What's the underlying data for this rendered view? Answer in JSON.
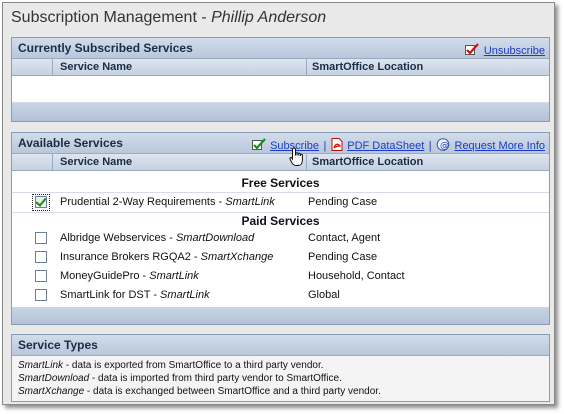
{
  "title": {
    "prefix": "Subscription Management - ",
    "user": "Phillip Anderson"
  },
  "subscribed": {
    "heading": "Currently Subscribed Services",
    "unsubscribe": "Unsubscribe",
    "col_name": "Service Name",
    "col_location": "SmartOffice Location"
  },
  "available": {
    "heading": "Available Services",
    "actions": {
      "subscribe": "Subscribe",
      "sep": "|",
      "pdf": "PDF DataSheet",
      "request": "Request More Info"
    },
    "col_name": "Service Name",
    "col_location": "SmartOffice Location",
    "free_label": "Free Services",
    "paid_label": "Paid Services",
    "free": [
      {
        "name": "Prudential 2-Way Requirements - ",
        "product": "SmartLink",
        "location": "Pending Case",
        "checked": true
      }
    ],
    "paid": [
      {
        "name": "Albridge Webservices - ",
        "product": "SmartDownload",
        "location": "Contact, Agent",
        "checked": false
      },
      {
        "name": "Insurance Brokers RGQA2 - ",
        "product": "SmartXchange",
        "location": "Pending Case",
        "checked": false
      },
      {
        "name": "MoneyGuidePro - ",
        "product": "SmartLink",
        "location": "Household, Contact",
        "checked": false
      },
      {
        "name": "SmartLink for DST - ",
        "product": "SmartLink",
        "location": "Global",
        "checked": false
      }
    ]
  },
  "types": {
    "heading": "Service Types",
    "lines": [
      {
        "term": "SmartLink",
        "text": " - data is exported from SmartOffice to a third party vendor."
      },
      {
        "term": "SmartDownload",
        "text": " - data is imported from third party vendor to SmartOffice."
      },
      {
        "term": "SmartXchange",
        "text": " - data is exchanged between SmartOffice and a third party vendor."
      }
    ]
  },
  "colors": {
    "header_bg": "#c5d1e0",
    "link": "#1a3cc8",
    "check": "#1c8a1c"
  },
  "icons": {
    "unsubscribe": "red-check-icon",
    "subscribe": "green-check-icon",
    "pdf": "pdf-icon",
    "request": "info-mail-icon",
    "cursor": "hand-cursor-icon"
  }
}
